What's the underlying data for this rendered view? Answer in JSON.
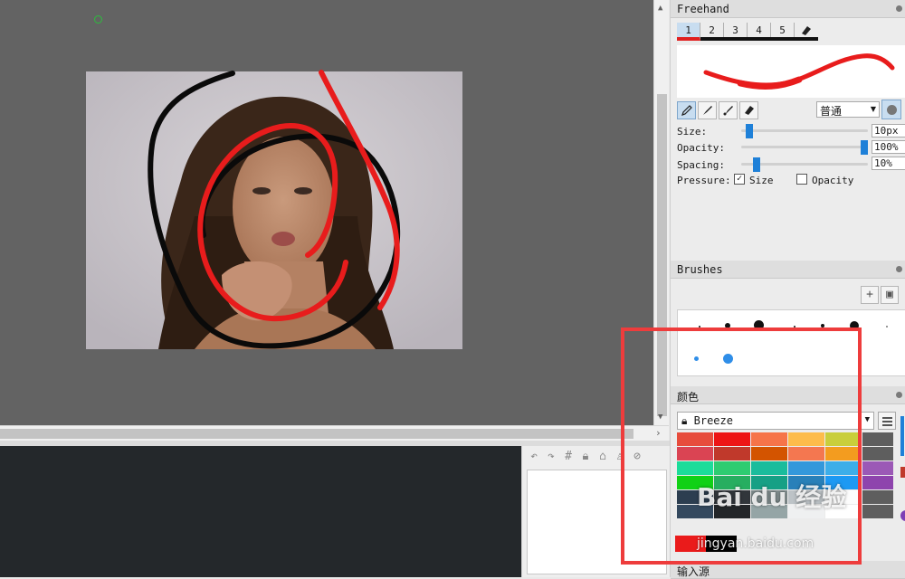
{
  "freehand": {
    "title": "Freehand",
    "tabs": [
      "1",
      "2",
      "3",
      "4",
      "5"
    ],
    "blend_mode": "普通",
    "size_label": "Size:",
    "size_value": "10px",
    "size_fraction": 0.04,
    "opacity_label": "Opacity:",
    "opacity_value": "100%",
    "opacity_fraction": 1.0,
    "spacing_label": "Spacing:",
    "spacing_value": "10%",
    "spacing_fraction": 0.1,
    "pressure_label": "Pressure:",
    "pressure_size_label": "Size",
    "pressure_size_checked": true,
    "pressure_opacity_label": "Opacity",
    "pressure_opacity_checked": false,
    "stroke_color": "#e81c1c"
  },
  "brushes": {
    "title": "Brushes",
    "add_icon": "plus-icon",
    "save_icon": "save-icon"
  },
  "colors": {
    "title": "颜色",
    "palette_name": "Breeze",
    "swatches": [
      "#e74c3c",
      "#ed1515",
      "#f67449",
      "#fdbc4b",
      "#c9ce3b",
      "#5e5e5e",
      "#da4453",
      "#c0392b",
      "#d35400",
      "#f47750",
      "#f39c1f",
      "#5e5e5e",
      "#1cdc9a",
      "#2ecc71",
      "#1abc9c",
      "#3498db",
      "#3daee9",
      "#9b59b6",
      "#11d116",
      "#27ae60",
      "#16a085",
      "#2980b9",
      "#1d99f3",
      "#8e44ad",
      "#2c3e50",
      "#31363b",
      "#7f8c8d",
      "#bdc3c7",
      "#fcfcfc",
      "#5e5e5e",
      "#34495e",
      "#232629",
      "#95a5a6",
      "#eff0f1",
      "#ffffff",
      "#5e5e5e"
    ],
    "foreground": "#ea1b1b",
    "background": "#000000"
  },
  "input_panel": {
    "title": "输入源"
  },
  "watermark": {
    "text": "Bai du 经验",
    "url": "jingyan.baidu.com"
  }
}
